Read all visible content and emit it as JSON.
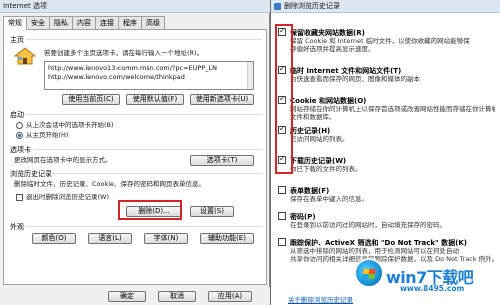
{
  "left_dialog": {
    "title": "Internet 选项",
    "tabs": [
      "常规",
      "安全",
      "隐私",
      "内容",
      "连接",
      "程序",
      "高级"
    ],
    "home": {
      "heading": "主页",
      "instruction": "若要创建多个主页选项卡，请在每行输入一个地址(R)。",
      "urls": [
        "http://www.lenovo13-comm.msn.com/?pc=EUPP_LN",
        "http://www.lenovo.com/welcome/thinkpad"
      ],
      "btn_current": "使用当前页(C)",
      "btn_default": "使用默认值(F)",
      "btn_blank": "使用新选项卡(U)"
    },
    "startup": {
      "heading": "启动",
      "option1": "从上次会话中的选项卡开始(B)",
      "option2": "从主页开始(H)"
    },
    "tabs_section": {
      "heading": "选项卡",
      "desc": "更改网页在选项卡中的显示方式。",
      "btn": "选项卡(T)"
    },
    "history": {
      "heading": "浏览历史记录",
      "desc": "删除临时文件、历史记录、Cookie、保存的密码和网页表单信息。",
      "checkbox": "退出时删除浏览历史记录(W)",
      "btn_delete": "删除(D)...",
      "btn_settings": "设置(S)"
    },
    "appearance": {
      "heading": "外观",
      "btn_colors": "颜色(O)",
      "btn_languages": "语言(L)",
      "btn_fonts": "字体(N)",
      "btn_accessibility": "辅助功能(E)"
    },
    "footer": {
      "ok": "确定",
      "cancel": "取消",
      "apply": "应用(A)"
    }
  },
  "right_dialog": {
    "title": "删除浏览历史记录",
    "options": [
      {
        "title": "保留收藏夹网站数据(R)",
        "desc1": "保留 Cookie 和 Internet 临时文件，以使你收藏的网站能够保",
        "desc2": "存偏好选项并提高显示速度。",
        "checked": true
      },
      {
        "title": "临时 Internet 文件和网站文件(T)",
        "desc1": "为快速查看而保存的网页、图像和媒体的副本",
        "desc2": "",
        "checked": true
      },
      {
        "title": "Cookie 和网站数据(O)",
        "desc1": "网站存储在你的计算机上以保存首选项或改善网站性能而存储在你计算机上的",
        "desc2": "文件和数据库。",
        "checked": true
      },
      {
        "title": "历史记录(H)",
        "desc1": "已访问网站的列表。",
        "desc2": "",
        "checked": true
      },
      {
        "title": "下载历史记录(W)",
        "desc1": "你已下载的文件的列表。",
        "desc2": "",
        "checked": true
      },
      {
        "title": "表单数据(F)",
        "desc1": "保存在表单中键入的信息。",
        "desc2": "",
        "checked": false
      },
      {
        "title": "密码(P)",
        "desc1": "在登录到以前访问过的网站时，自动填充保存的密码。",
        "desc2": "",
        "checked": false
      },
      {
        "title": "跟踪保护、ActiveX 筛选和 \"Do Not Track\" 数据(K)",
        "desc1": "从筛选中排除的网站的列表，用于检测网站可以在何处自动",
        "desc2": "共享你访问的相关详细信息的跟踪保护数据，以及 Do Not Track 例外。",
        "checked": false
      }
    ],
    "link": "关于删除浏览历史记录"
  },
  "watermark": {
    "brand": "win7下载吧",
    "url": "www.8495.com"
  }
}
